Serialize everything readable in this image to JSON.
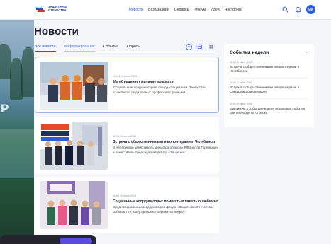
{
  "header": {
    "logo_text": "ЗАЩИТНИКИ ОТЕЧЕСТВА",
    "nav": [
      "Новости",
      "База знаний",
      "Сервисы",
      "Форум",
      "Идеи",
      "Настройки"
    ],
    "avatar_initials": "ИИ"
  },
  "page": {
    "title": "Новости",
    "tabs": [
      "Все новости",
      "Информирование",
      "События",
      "Опросы"
    ],
    "active_tab": "Все новости"
  },
  "news": [
    {
      "meta": "13:54, 8 июня 2024",
      "title": "Их объединяет желание помогать",
      "text": "Социальным координаторам фонда «Защитники Отечества» становятся люди разных профессий с разными..."
    },
    {
      "meta": "11:54, 8 июня 2024",
      "title": "Встреча с общественниками и волонтерами в Челябинске",
      "text": "В Челябинске заместитель министра обороны РФ Виктор Горемыкин и заместитель председателя фонда «Защитник..."
    },
    {
      "meta": "11:54, 8 июня 2024",
      "title": "Социальные координаторы: помогать в память о любимых",
      "text": "Среди социальных координаторов фонда «Защитники Отечества» работают те, кому пришлось пережить потерю..."
    }
  ],
  "sidebar": {
    "title": "События недели",
    "items": [
      {
        "date": "11:54, 8 июня 2024",
        "text": "Встреча с общественниками и волонтерами в Челябинске"
      },
      {
        "date": "11:54, 7 июня 2024",
        "text": "Встреча с общественниками и волонтерами в Свердловском филиале"
      },
      {
        "date": "11:54, 8 июня 2024",
        "text": "Максимум 3 события недели, остальные события при переходе по стрелке"
      }
    ]
  },
  "colors": {
    "accent": "#2d5bd6",
    "background": "#eef1f6",
    "card": "#ffffff",
    "toast": "#22242e",
    "toast_button": "#5b4be0"
  }
}
